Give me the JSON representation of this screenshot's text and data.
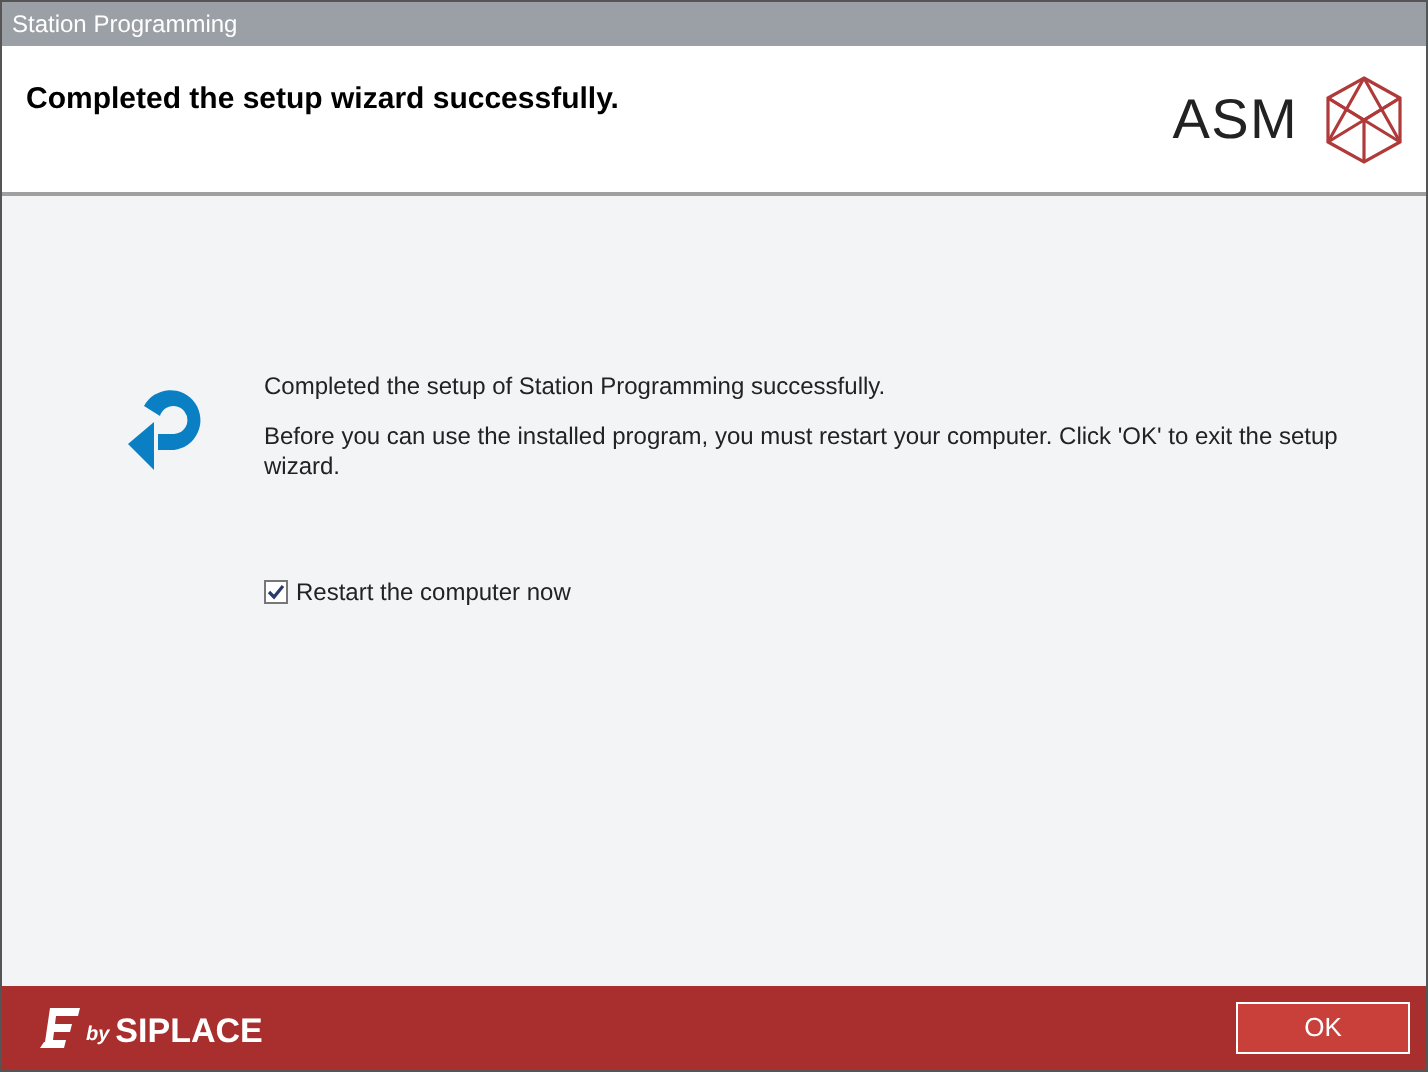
{
  "window": {
    "title": "Station Programming"
  },
  "header": {
    "heading": "Completed the setup wizard successfully.",
    "logo": {
      "text": "ASM"
    }
  },
  "body": {
    "paragraphs": [
      "Completed the setup of Station Programming successfully.",
      "Before you can use the installed program, you must restart your computer. Click 'OK' to exit the setup wizard."
    ],
    "checkbox": {
      "label": "Restart the computer now",
      "checked": true
    }
  },
  "footer": {
    "logo": {
      "by": "by",
      "brand": "SIPLACE"
    },
    "buttons": [
      "OK"
    ]
  }
}
